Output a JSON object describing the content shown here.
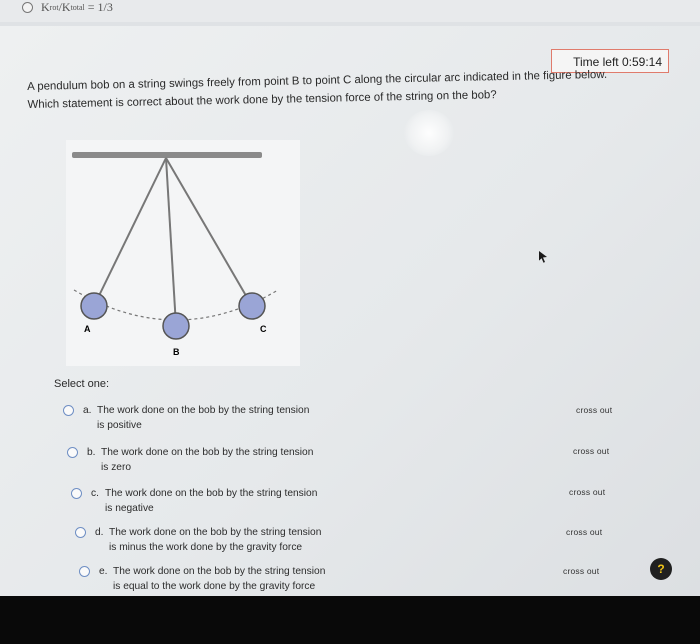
{
  "previous_item": {
    "formula_text": "K",
    "rot_sub": "rot",
    "total_sub": "total",
    "value_text": "= 1/3"
  },
  "timer": {
    "label": "Time left 0:59:14"
  },
  "question": {
    "text": "A pendulum bob on a string swings freely from point B to point C along the circular arc indicated in the figure below. Which statement is correct about the work done by the tension force of the string on the bob?"
  },
  "figure": {
    "points": {
      "a": "A",
      "b": "B",
      "c": "C"
    },
    "colors": {
      "bob": "#9aa5d6",
      "string": "#777777",
      "ceiling": "#8a8a8a"
    }
  },
  "select_one_label": "Select one:",
  "options": [
    {
      "letter": "a.",
      "line1": "The work done on the bob by the string tension",
      "line2": "is positive",
      "cross_out": "cross out"
    },
    {
      "letter": "b.",
      "line1": "The work done on the bob by the string tension",
      "line2": "is zero",
      "cross_out": "cross out"
    },
    {
      "letter": "c.",
      "line1": "The work done on the bob by the string tension",
      "line2": "is negative",
      "cross_out": "cross out"
    },
    {
      "letter": "d.",
      "line1": "The work done on the bob by the string tension",
      "line2": "is minus the work done by the gravity force",
      "cross_out": "cross out"
    },
    {
      "letter": "e.",
      "line1": "The work done on the bob by the string tension",
      "line2": "is equal to the work done by the gravity force",
      "cross_out": "cross out"
    }
  ],
  "help": {
    "glyph": "?"
  },
  "accent": {
    "timer_border": "#e07b6c",
    "radio": "#6f8fc4",
    "help_bg": "#202020",
    "help_fg": "#f0c419"
  }
}
